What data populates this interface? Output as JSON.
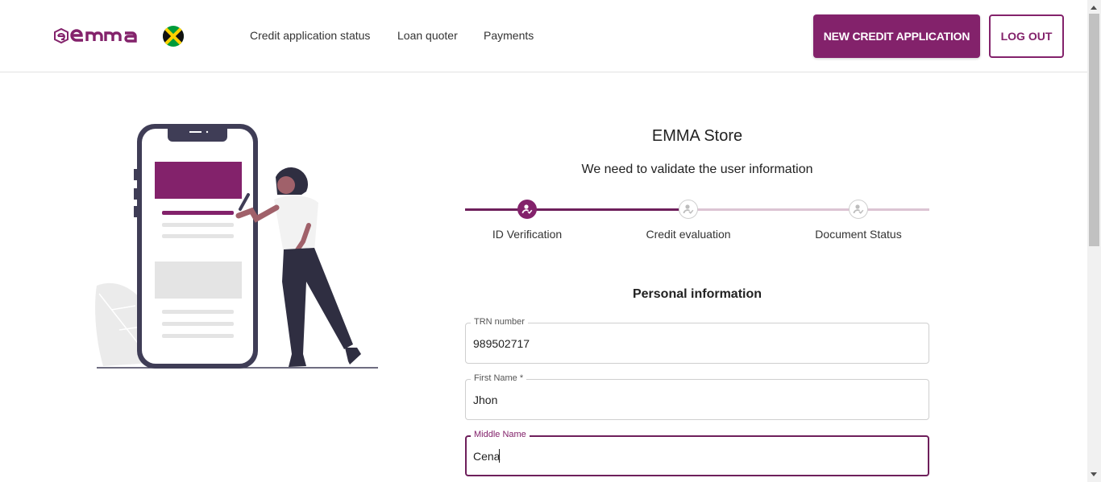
{
  "header": {
    "brand": "emma",
    "nav": [
      {
        "label": "Credit application status"
      },
      {
        "label": "Loan quoter"
      },
      {
        "label": "Payments"
      }
    ],
    "new_application_label": "NEW CREDIT APPLICATION",
    "logout_label": "LOG OUT"
  },
  "main": {
    "store_title": "EMMA Store",
    "subtitle": "We need to validate the user information",
    "steps": [
      {
        "label": "ID Verification",
        "state": "active"
      },
      {
        "label": "Credit evaluation",
        "state": "inactive"
      },
      {
        "label": "Document Status",
        "state": "inactive"
      }
    ],
    "section_title": "Personal information",
    "fields": [
      {
        "label": "TRN number",
        "value": "989502717"
      },
      {
        "label": "First Name *",
        "value": "Jhon"
      },
      {
        "label": "Middle Name",
        "value": "Cena",
        "focused": true
      }
    ]
  },
  "colors": {
    "brand": "#83226b",
    "brand_dark": "#6e1f5b",
    "step_inactive_track": "#dcc4d3"
  },
  "icons": [
    "emma-logo-icon",
    "jamaica-flag-icon",
    "user-check-icon"
  ]
}
